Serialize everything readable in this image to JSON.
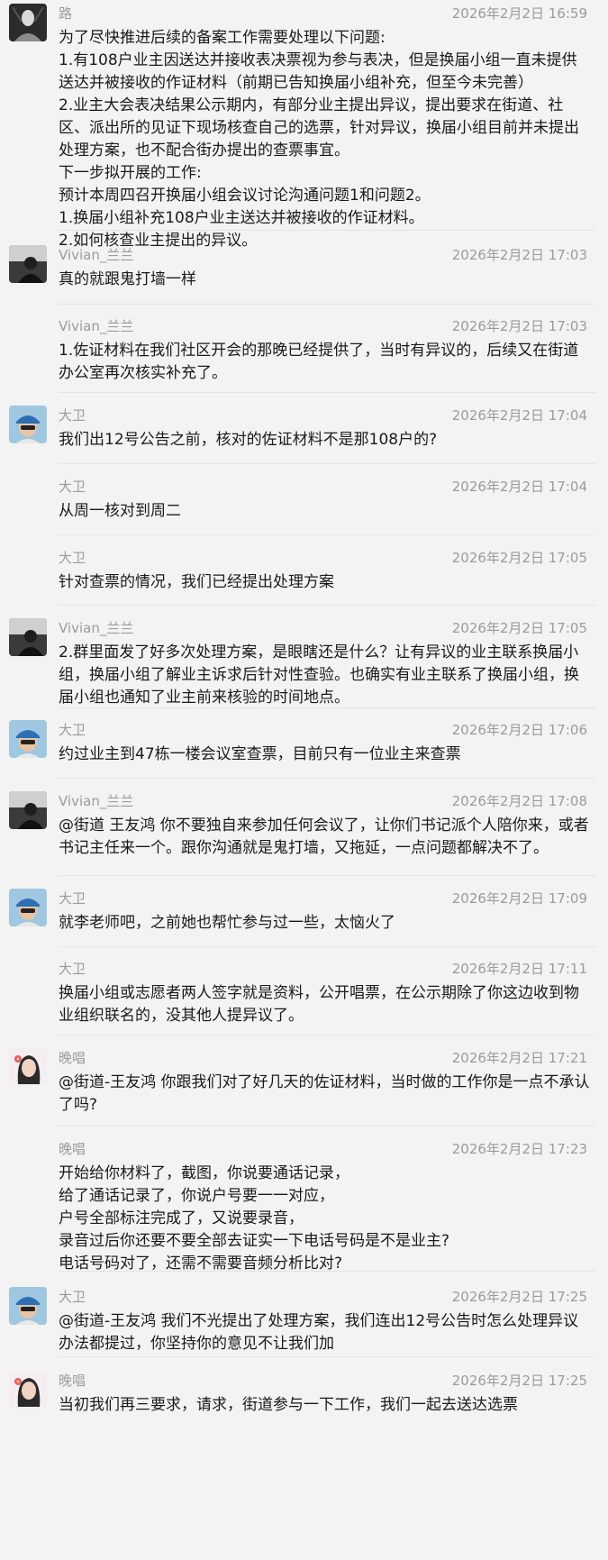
{
  "messages": [
    {
      "sender": "路",
      "time": "2026年2月2日 16:59",
      "avatar": "black-white-portrait-avatar",
      "text": "为了尽快推进后续的备案工作需要处理以下问题:\n1.有108户业主因送达并接收表决票视为参与表决，但是换届小组一直未提供送达并被接收的作证材料（前期已告知换届小组补充，但至今未完善）\n2.业主大会表决结果公示期内，有部分业主提出异议，提出要求在街道、社区、派出所的见证下现场核查自己的选票，针对异议，换届小组目前并未提出处理方案，也不配合街办提出的查票事宜。\n下一步拟开展的工作:\n预计本周四召开换届小组会议讨论沟通问题1和问题2。\n1.换届小组补充108户业主送达并被接收的作证材料。\n2.如何核查业主提出的异议。"
    },
    {
      "sender": "Vivian_兰兰",
      "time": "2026年2月2日 17:03",
      "avatar": "dark-figure-avatar",
      "text": "真的就跟鬼打墙一样"
    },
    {
      "sender": "Vivian_兰兰",
      "time": "2026年2月2日 17:03",
      "avatar": "",
      "text": "1.佐证材料在我们社区开会的那晚已经提供了，当时有异议的，后续又在街道办公室再次核实补充了。"
    },
    {
      "sender": "大卫",
      "time": "2026年2月2日 17:04",
      "avatar": "blue-cap-man-avatar",
      "text": "我们出12号公告之前，核对的佐证材料不是那108户的?"
    },
    {
      "sender": "大卫",
      "time": "2026年2月2日 17:04",
      "avatar": "",
      "text": "从周一核对到周二"
    },
    {
      "sender": "大卫",
      "time": "2026年2月2日 17:05",
      "avatar": "",
      "text": "针对查票的情况，我们已经提出处理方案"
    },
    {
      "sender": "Vivian_兰兰",
      "time": "2026年2月2日 17:05",
      "avatar": "dark-figure-avatar",
      "text": "2.群里面发了好多次处理方案，是眼瞎还是什么？让有异议的业主联系换届小组，换届小组了解业主诉求后针对性查验。也确实有业主联系了换届小组，换届小组也通知了业主前来核验的时间地点。"
    },
    {
      "sender": "大卫",
      "time": "2026年2月2日 17:06",
      "avatar": "blue-cap-man-avatar",
      "text": "约过业主到47栋一楼会议室查票，目前只有一位业主来查票"
    },
    {
      "sender": "Vivian_兰兰",
      "time": "2026年2月2日 17:08",
      "avatar": "dark-figure-avatar",
      "text": "@街道 王友鸿 你不要独自来参加任何会议了，让你们书记派个人陪你来，或者书记主任来一个。跟你沟通就是鬼打墙，又拖延，一点问题都解决不了。"
    },
    {
      "sender": "大卫",
      "time": "2026年2月2日 17:09",
      "avatar": "blue-cap-man-avatar",
      "text": "就李老师吧，之前她也帮忙参与过一些，太恼火了"
    },
    {
      "sender": "大卫",
      "time": "2026年2月2日 17:11",
      "avatar": "",
      "text": "换届小组或志愿者两人签字就是资料，公开唱票，在公示期除了你这边收到物业组织联名的，没其他人提异议了。"
    },
    {
      "sender": "晚唱",
      "time": "2026年2月2日 17:21",
      "avatar": "woman-with-flower-avatar",
      "text": "@街道-王友鸿 你跟我们对了好几天的佐证材料，当时做的工作你是一点不承认了吗?"
    },
    {
      "sender": "晚唱",
      "time": "2026年2月2日 17:23",
      "avatar": "",
      "text": "开始给你材料了，截图，你说要通话记录，\n给了通话记录了，你说户号要一一对应，\n户号全部标注完成了，又说要录音，\n录音过后你还要不要全部去证实一下电话号码是不是业主?\n电话号码对了，还需不需要音频分析比对?"
    },
    {
      "sender": "大卫",
      "time": "2026年2月2日 17:25",
      "avatar": "blue-cap-man-avatar",
      "text": "@街道-王友鸿 我们不光提出了处理方案，我们连出12号公告时怎么处理异议办法都提过，你坚持你的意见不让我们加"
    },
    {
      "sender": "晚唱",
      "time": "2026年2月2日 17:25",
      "avatar": "woman-with-flower-avatar",
      "text": "当初我们再三要求，请求，街道参与一下工作，我们一起去送达选票"
    }
  ]
}
